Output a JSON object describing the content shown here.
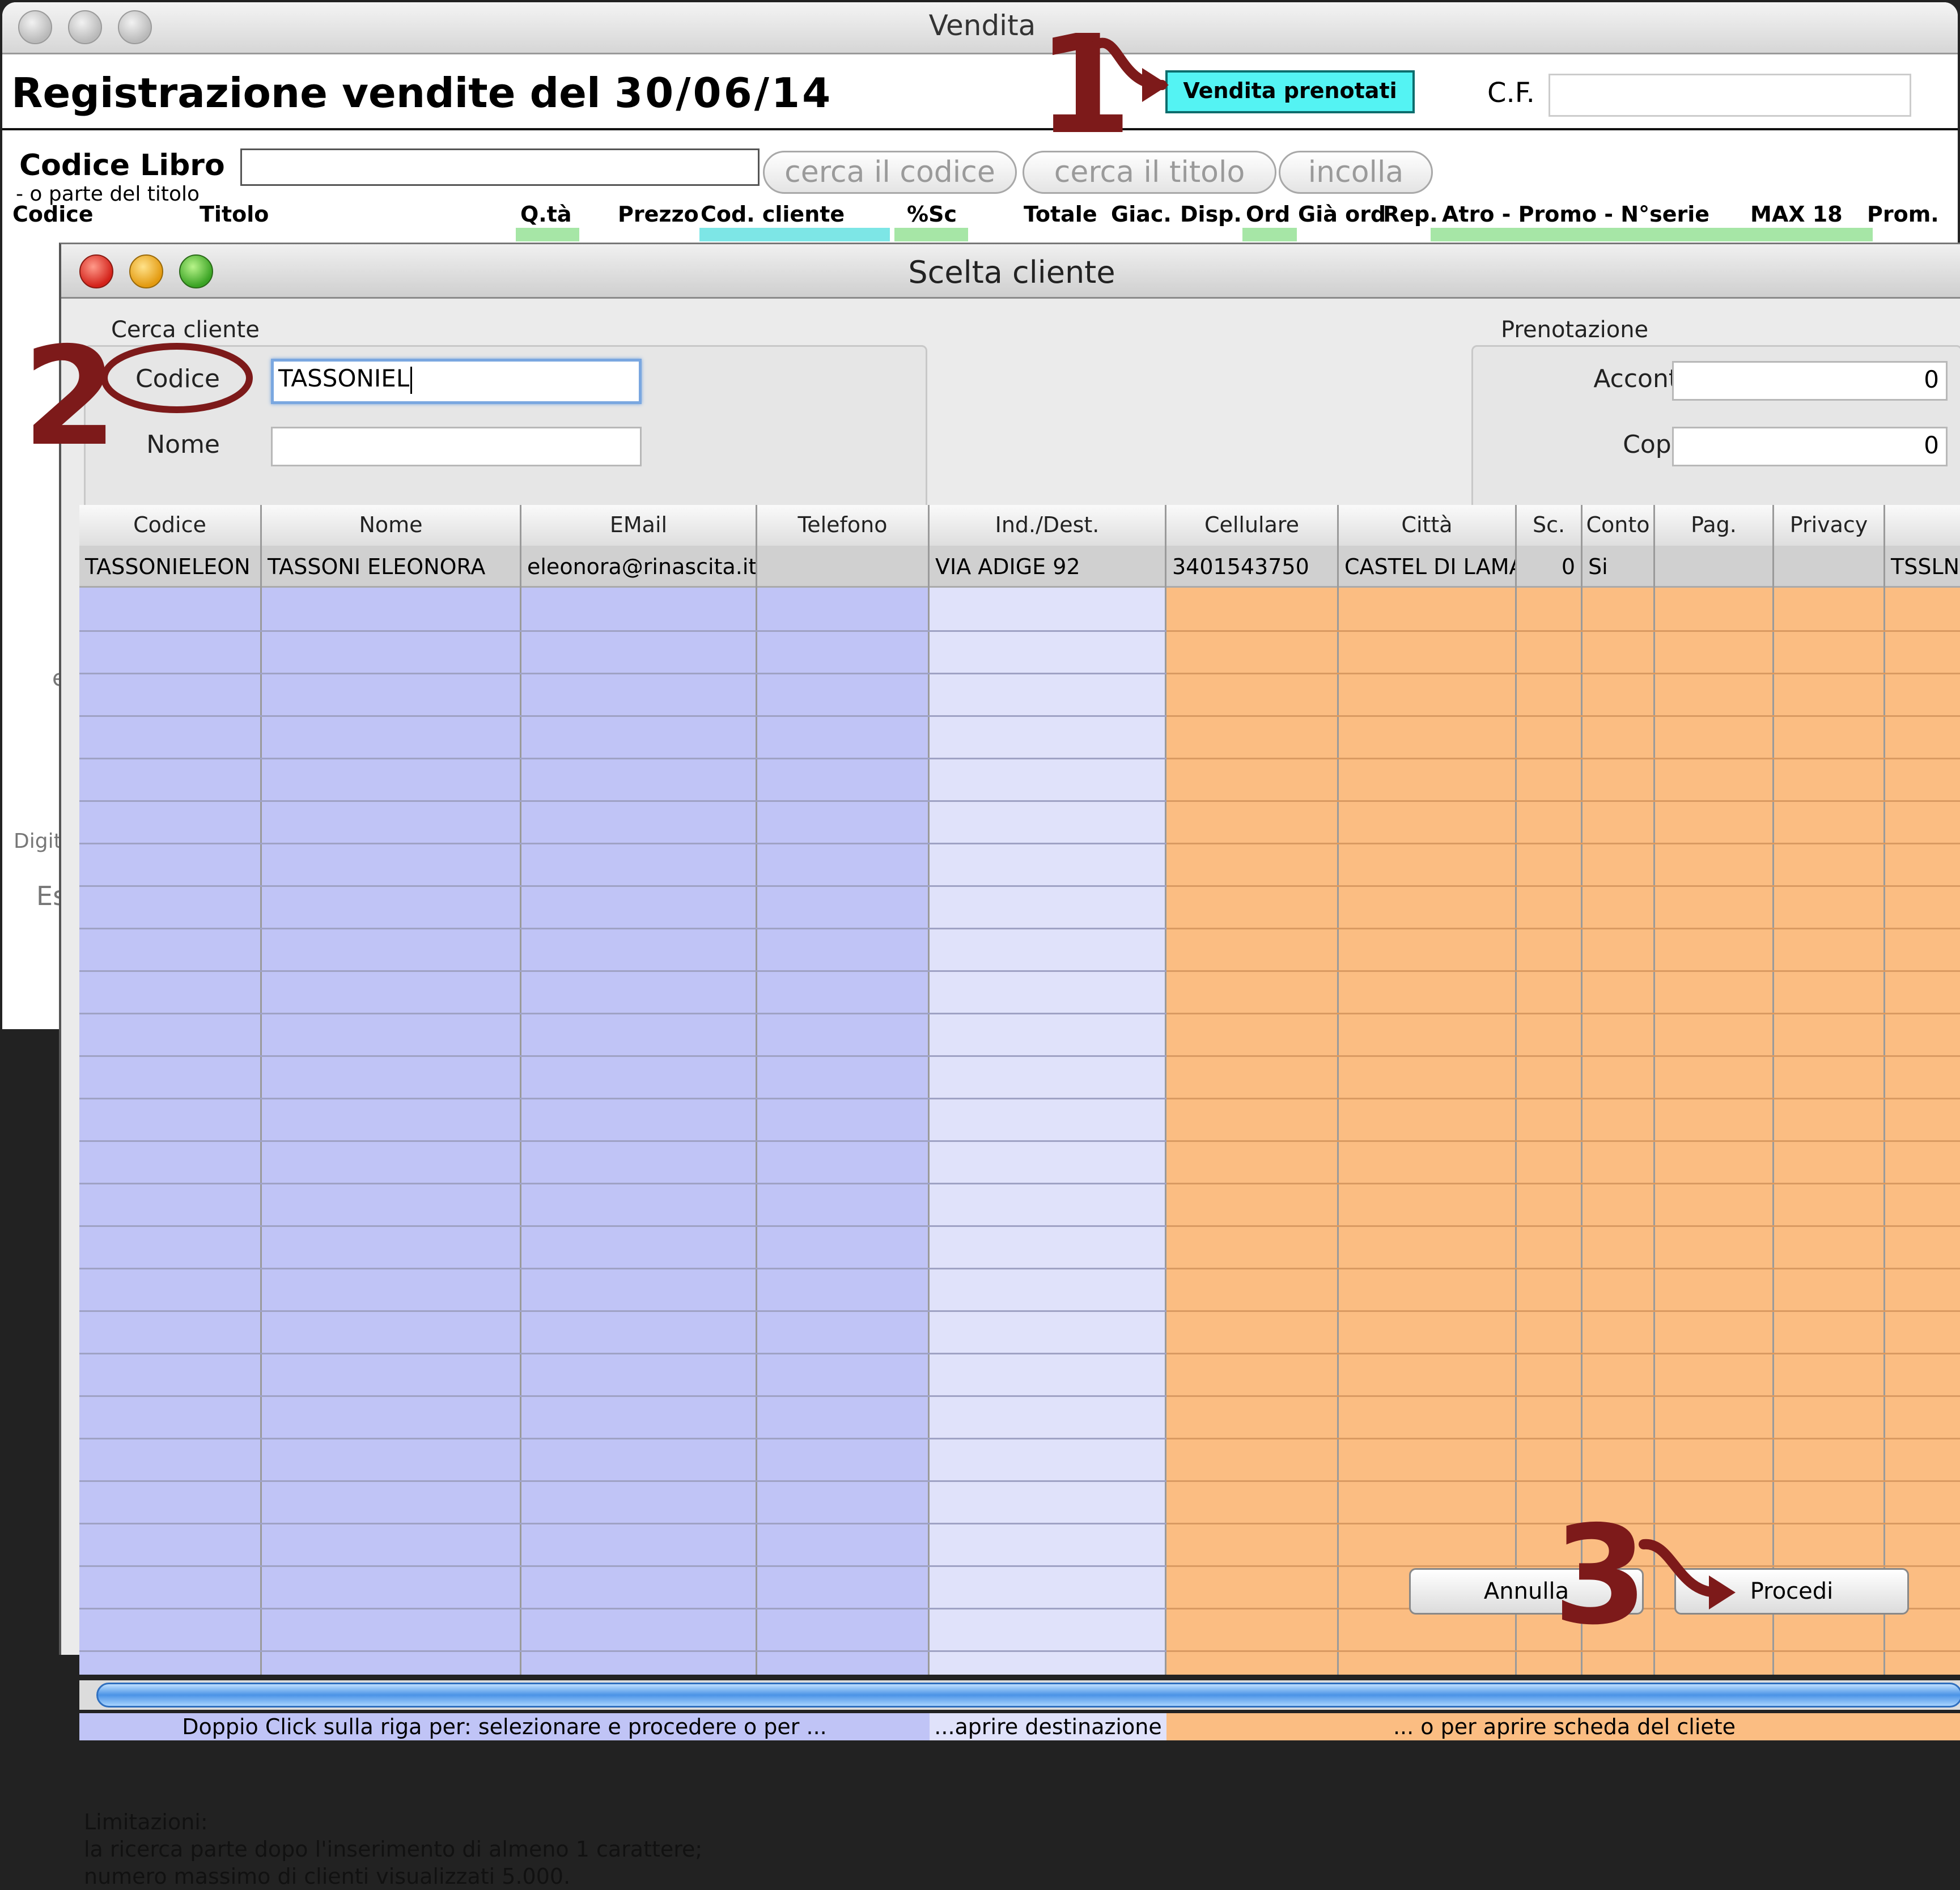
{
  "background_window": {
    "title": "Vendita",
    "header_title": "Registrazione vendite del",
    "date": "30/06/14",
    "btn_prenotati": "Vendita prenotati",
    "cf_label": "C.F.",
    "codice_libro_label": "Codice Libro",
    "codice_libro_sub": "- o parte del  titolo",
    "btn_cerca_codice": "cerca il codice",
    "btn_cerca_titolo": "cerca il titolo",
    "btn_incolla": "incolla",
    "columns": [
      "Codice",
      "Titolo",
      "Q.tà",
      "Prezzo",
      "Cod. cliente",
      "%Sc",
      "Totale",
      "Giac.",
      "Disp.",
      "Ord",
      "Già ord",
      "Rep.",
      "Atro - Promo - N°serie",
      "MAX 18",
      "Prom."
    ],
    "left_fragments": [
      "e",
      "Digit",
      "Es"
    ]
  },
  "dialog": {
    "title": "Scelta cliente",
    "search_group_label": "Cerca cliente",
    "codice_label": "Codice",
    "codice_value": "TASSONIEL",
    "nome_label": "Nome",
    "nome_value": "",
    "booking_group_label": "Prenotazione",
    "acconto_label": "Acconto",
    "acconto_value": "0",
    "copie_label": "Copie",
    "copie_value": "0",
    "table": {
      "headers": [
        "Codice",
        "Nome",
        "EMail",
        "Telefono",
        "Ind./Dest.",
        "Cellulare",
        "Città",
        "Sc.",
        "Conto",
        "Pag.",
        "Privacy",
        ""
      ],
      "row": {
        "codice": "TASSONIELEON",
        "nome": "TASSONI ELEONORA",
        "email": "eleonora@rinascita.it",
        "telefono": "",
        "indirizzo": "VIA ADIGE 92",
        "cellulare": "3401543750",
        "citta": "CASTEL DI LAMA",
        "sconto": "0",
        "conto": "Si",
        "pag": "",
        "privacy": "",
        "extra": "TSSLNR"
      }
    },
    "hints": {
      "select": "Doppio Click sulla riga per: selezionare e procedere o per ...",
      "destination": "...aprire destinazione",
      "customer_sheet": "... o per aprire scheda del cliete"
    },
    "limits": {
      "title": "Limitazioni:",
      "line1": "la ricerca parte dopo l'inserimento di almeno 1 carattere;",
      "line2": "numero massimo di clienti visualizzati 5.000."
    },
    "btn_annulla": "Annulla",
    "btn_procedi": "Procedi"
  },
  "annotations": [
    "1",
    "2",
    "3"
  ],
  "colors": {
    "accent_cyan": "#54f3f3",
    "annotation_red": "#7d1a1a",
    "grid_blue": "#c0c4f6",
    "grid_lightblue": "#e0e2fa",
    "grid_orange": "#fbbd82"
  }
}
